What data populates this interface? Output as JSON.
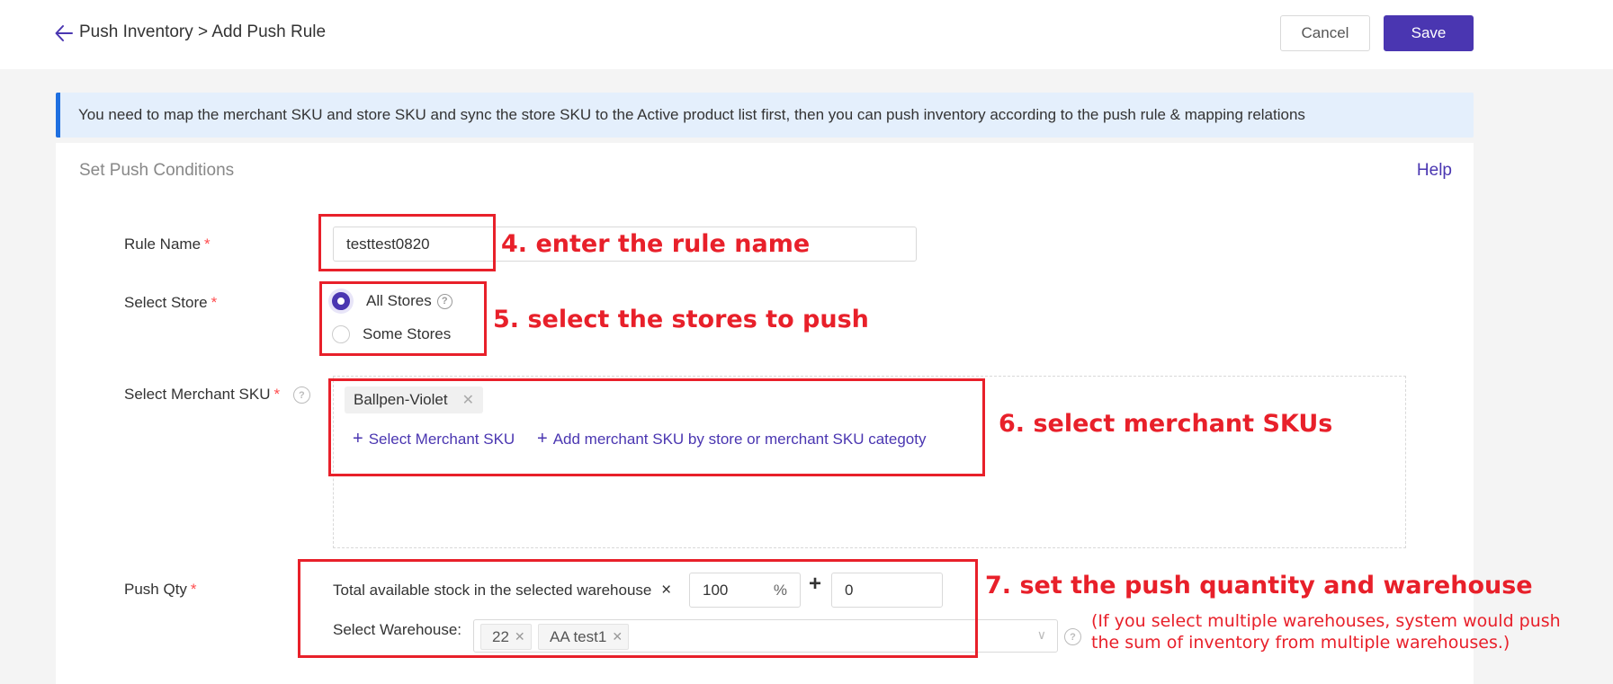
{
  "header": {
    "back_icon": "arrow-left-icon",
    "breadcrumb": "Push Inventory > Add Push Rule",
    "cancel_label": "Cancel",
    "save_label": "Save"
  },
  "banner": {
    "text": "You need to map the merchant SKU and store SKU and sync the store SKU to the Active product list first, then you can push inventory according to the push rule & mapping relations"
  },
  "card": {
    "title": "Set Push Conditions",
    "help_label": "Help"
  },
  "form": {
    "rule_name": {
      "label": "Rule Name",
      "required": "*",
      "value": "testtest0820"
    },
    "select_store": {
      "label": "Select Store",
      "required": "*",
      "options": [
        {
          "label": "All Stores",
          "selected": true,
          "help_icon": "question-circle-icon"
        },
        {
          "label": "Some Stores",
          "selected": false
        }
      ]
    },
    "merchant_sku": {
      "label": "Select Merchant SKU",
      "required": "*",
      "help_icon": "question-circle-icon",
      "selected_tags": [
        "Ballpen-Violet"
      ],
      "select_link": "Select Merchant SKU",
      "add_link": "Add merchant SKU by store or merchant SKU categoty"
    },
    "push_qty": {
      "label": "Push Qty",
      "required": "*",
      "formula_text": "Total available stock in the selected warehouse",
      "multiply_sign": "×",
      "percent_value": "100",
      "percent_unit": "%",
      "plus_sign": "+",
      "offset_value": "0",
      "warehouse_label": "Select Warehouse:",
      "warehouses": [
        "22",
        "AA test1"
      ]
    }
  },
  "annotations": {
    "step4": "4. enter the rule name",
    "step5": "5. select the stores to push",
    "step6": "6. select merchant SKUs",
    "step7": "7. set the push quantity and warehouse",
    "note_line1": "(If you select multiple warehouses, system would push",
    "note_line2": "the sum of inventory from multiple warehouses.)",
    "color": "#e8202a"
  },
  "colors": {
    "primary": "#4a36b1",
    "banner_bg": "#e4effc",
    "banner_accent": "#1e6fe0",
    "required": "#ff4d4f"
  }
}
